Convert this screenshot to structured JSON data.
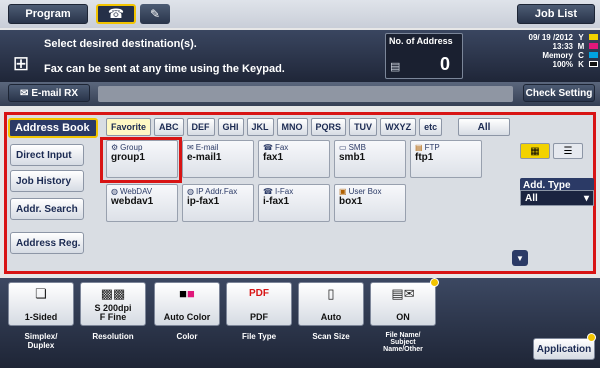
{
  "topbar": {
    "program": "Program",
    "job_list": "Job List"
  },
  "message": {
    "line1": "Select desired destination(s).",
    "line2": "Fax can be sent at any time using the Keypad.",
    "no_of_address_label": "No. of Address",
    "no_of_address_value": "0"
  },
  "status": {
    "date": "09/ 19 /2012",
    "time": "13:33",
    "memory_label": "Memory",
    "memory_value": "100%",
    "toner": [
      "Y",
      "M",
      "C",
      "K"
    ],
    "toner_colors": [
      "#f2d200",
      "#e0187a",
      "#00a3e0",
      "#111111"
    ]
  },
  "email_rx": "E-mail RX",
  "check_setting": "Check Setting",
  "left_menu": {
    "address_book": "Address Book",
    "direct_input": "Direct Input",
    "job_history": "Job History",
    "addr_search": "Addr. Search",
    "address_reg": "Address Reg."
  },
  "tabs": [
    "Favorite",
    "ABC",
    "DEF",
    "GHI",
    "JKL",
    "MNO",
    "PQRS",
    "TUV",
    "WXYZ",
    "etc"
  ],
  "tab_all": "All",
  "tiles": [
    {
      "kind": "Group",
      "name": "group1",
      "icon": "group-icon"
    },
    {
      "kind": "E-mail",
      "name": "e-mail1",
      "icon": "email-icon"
    },
    {
      "kind": "Fax",
      "name": "fax1",
      "icon": "fax-icon"
    },
    {
      "kind": "SMB",
      "name": "smb1",
      "icon": "smb-icon"
    },
    {
      "kind": "FTP",
      "name": "ftp1",
      "icon": "ftp-icon"
    },
    {
      "kind": "WebDAV",
      "name": "webdav1",
      "icon": "webdav-icon"
    },
    {
      "kind": "IP Addr.Fax",
      "name": "ip-fax1",
      "icon": "ip-fax-icon"
    },
    {
      "kind": "I-Fax",
      "name": "i-fax1",
      "icon": "i-fax-icon"
    },
    {
      "kind": "User Box",
      "name": "box1",
      "icon": "user-box-icon"
    }
  ],
  "add_type": {
    "label": "Add. Type",
    "value": "All"
  },
  "functions": [
    {
      "value": "1-Sided",
      "label": "Simplex/\nDuplex",
      "icon": "simplex-icon"
    },
    {
      "value": "S 200dpi\nF Fine",
      "label": "Resolution",
      "icon": "resolution-icon"
    },
    {
      "value": "Auto Color",
      "label": "Color",
      "icon": "color-icon"
    },
    {
      "value": "PDF",
      "label": "File Type",
      "icon": "pdf-icon"
    },
    {
      "value": "Auto",
      "label": "Scan Size",
      "icon": "scan-size-icon"
    },
    {
      "value": "ON",
      "label": "File Name/\nSubject\nName/Other",
      "icon": "file-name-icon"
    }
  ],
  "application": "Application",
  "accent_color": "#f2c400",
  "highlight_color": "#d81414"
}
